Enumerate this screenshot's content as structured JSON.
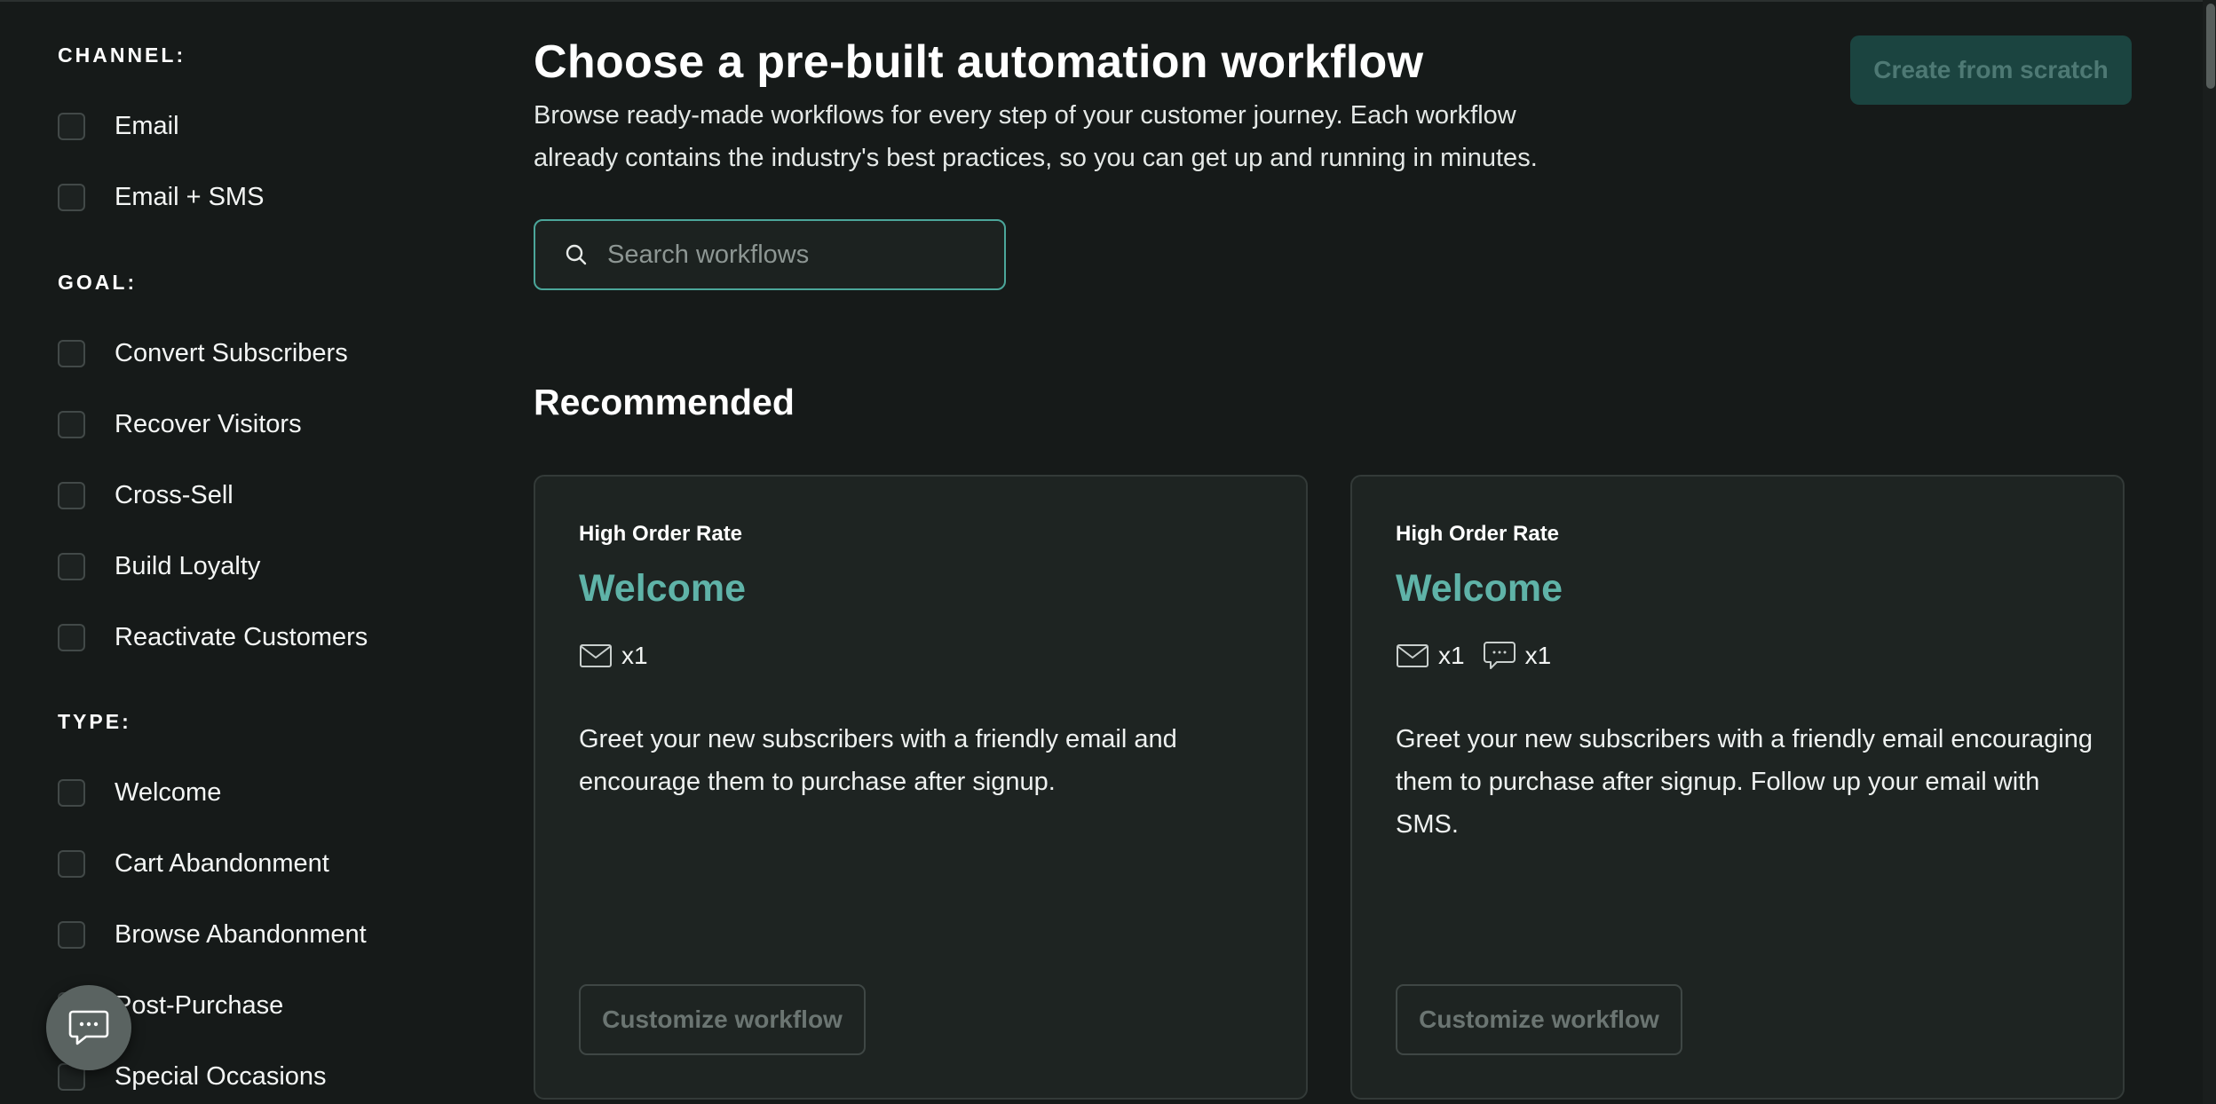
{
  "sidebar": {
    "channel": {
      "heading": "CHANNEL:",
      "items": [
        {
          "label": "Email"
        },
        {
          "label": "Email + SMS"
        }
      ]
    },
    "goal": {
      "heading": "GOAL:",
      "items": [
        {
          "label": "Convert Subscribers"
        },
        {
          "label": "Recover Visitors"
        },
        {
          "label": "Cross-Sell"
        },
        {
          "label": "Build Loyalty"
        },
        {
          "label": "Reactivate Customers"
        }
      ]
    },
    "type": {
      "heading": "TYPE:",
      "items": [
        {
          "label": "Welcome"
        },
        {
          "label": "Cart Abandonment"
        },
        {
          "label": "Browse Abandonment"
        },
        {
          "label": "Post-Purchase"
        },
        {
          "label": "Special Occasions"
        }
      ]
    }
  },
  "header": {
    "title": "Choose a pre-built automation workflow",
    "description": "Browse ready-made workflows for every step of your customer journey. Each workflow already contains the industry's best practices, so you can get up and running in minutes.",
    "create_button": "Create from scratch"
  },
  "search": {
    "placeholder": "Search workflows",
    "value": ""
  },
  "recommended": {
    "title": "Recommended",
    "cards": [
      {
        "badge": "High Order Rate",
        "title": "Welcome",
        "channels": [
          {
            "icon": "email-icon",
            "count": "x1"
          }
        ],
        "description": "Greet your new subscribers with a friendly email and encourage them to purchase after signup.",
        "button": "Customize workflow"
      },
      {
        "badge": "High Order Rate",
        "title": "Welcome",
        "channels": [
          {
            "icon": "email-icon",
            "count": "x1"
          },
          {
            "icon": "sms-icon",
            "count": "x1"
          }
        ],
        "description": "Greet your new subscribers with a friendly email encouraging them to purchase after signup. Follow up your email with SMS.",
        "button": "Customize workflow"
      }
    ]
  },
  "colors": {
    "background": "#161a19",
    "accent": "#5fb3a8",
    "card": "#1e2422",
    "primary_button_disabled": "#1b4440"
  }
}
